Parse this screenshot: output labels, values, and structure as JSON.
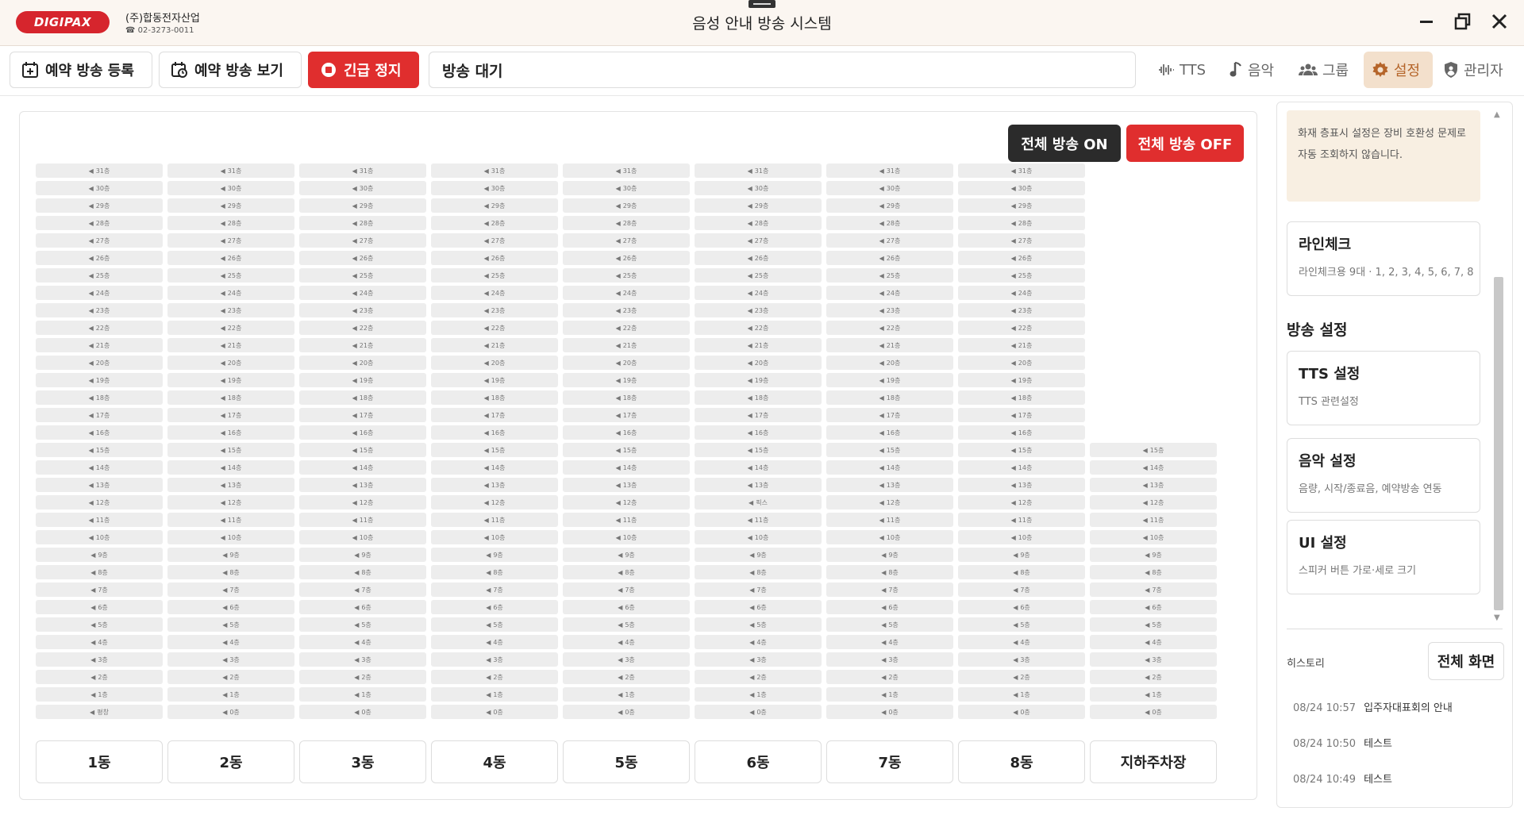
{
  "header": {
    "logo_text": "DIGIPAX",
    "company_name": "(주)합동전자산업",
    "company_phone": "☎ 02-3273-0011",
    "app_title": "음성 안내 방송 시스템",
    "brand_color": "#d6252d"
  },
  "toolbar": {
    "schedule_register": "예약 방송 등록",
    "schedule_view": "예약 방송 보기",
    "emergency_stop": "긴급 정지",
    "status_text": "방송 대기",
    "nav": {
      "tts": "TTS",
      "music": "음악",
      "group": "그룹",
      "settings": "설정",
      "admin": "관리자"
    }
  },
  "main": {
    "all_on": "전체 방송 ON",
    "all_off": "전체 방송 OFF",
    "buildings": [
      {
        "label": "1동",
        "floors": [
          "31층",
          "30층",
          "29층",
          "28층",
          "27층",
          "26층",
          "25층",
          "24층",
          "23층",
          "22층",
          "21층",
          "20층",
          "19층",
          "18층",
          "17층",
          "16층",
          "15층",
          "14층",
          "13층",
          "12층",
          "11층",
          "10층",
          "9층",
          "8층",
          "7층",
          "6층",
          "5층",
          "4층",
          "3층",
          "2층",
          "1층",
          "평창"
        ]
      },
      {
        "label": "2동",
        "floors": [
          "31층",
          "30층",
          "29층",
          "28층",
          "27층",
          "26층",
          "25층",
          "24층",
          "23층",
          "22층",
          "21층",
          "20층",
          "19층",
          "18층",
          "17층",
          "16층",
          "15층",
          "14층",
          "13층",
          "12층",
          "11층",
          "10층",
          "9층",
          "8층",
          "7층",
          "6층",
          "5층",
          "4층",
          "3층",
          "2층",
          "1층",
          "0층"
        ]
      },
      {
        "label": "3동",
        "floors": [
          "31층",
          "30층",
          "29층",
          "28층",
          "27층",
          "26층",
          "25층",
          "24층",
          "23층",
          "22층",
          "21층",
          "20층",
          "19층",
          "18층",
          "17층",
          "16층",
          "15층",
          "14층",
          "13층",
          "12층",
          "11층",
          "10층",
          "9층",
          "8층",
          "7층",
          "6층",
          "5층",
          "4층",
          "3층",
          "2층",
          "1층",
          "0층"
        ]
      },
      {
        "label": "4동",
        "floors": [
          "31층",
          "30층",
          "29층",
          "28층",
          "27층",
          "26층",
          "25층",
          "24층",
          "23층",
          "22층",
          "21층",
          "20층",
          "19층",
          "18층",
          "17층",
          "16층",
          "15층",
          "14층",
          "13층",
          "12층",
          "11층",
          "10층",
          "9층",
          "8층",
          "7층",
          "6층",
          "5층",
          "4층",
          "3층",
          "2층",
          "1층",
          "0층"
        ]
      },
      {
        "label": "5동",
        "floors": [
          "31층",
          "30층",
          "29층",
          "28층",
          "27층",
          "26층",
          "25층",
          "24층",
          "23층",
          "22층",
          "21층",
          "20층",
          "19층",
          "18층",
          "17층",
          "16층",
          "15층",
          "14층",
          "13층",
          "12층",
          "11층",
          "10층",
          "9층",
          "8층",
          "7층",
          "6층",
          "5층",
          "4층",
          "3층",
          "2층",
          "1층",
          "0층"
        ]
      },
      {
        "label": "6동",
        "floors": [
          "31층",
          "30층",
          "29층",
          "28층",
          "27층",
          "26층",
          "25층",
          "24층",
          "23층",
          "22층",
          "21층",
          "20층",
          "19층",
          "18층",
          "17층",
          "16층",
          "15층",
          "14층",
          "13층",
          "픽스",
          "11층",
          "10층",
          "9층",
          "8층",
          "7층",
          "6층",
          "5층",
          "4층",
          "3층",
          "2층",
          "1층",
          "0층"
        ]
      },
      {
        "label": "7동",
        "floors": [
          "31층",
          "30층",
          "29층",
          "28층",
          "27층",
          "26층",
          "25층",
          "24층",
          "23층",
          "22층",
          "21층",
          "20층",
          "19층",
          "18층",
          "17층",
          "16층",
          "15층",
          "14층",
          "13층",
          "12층",
          "11층",
          "10층",
          "9층",
          "8층",
          "7층",
          "6층",
          "5층",
          "4층",
          "3층",
          "2층",
          "1층",
          "0층"
        ]
      },
      {
        "label": "8동",
        "floors": [
          "31층",
          "30층",
          "29층",
          "28층",
          "27층",
          "26층",
          "25층",
          "24층",
          "23층",
          "22층",
          "21층",
          "20층",
          "19층",
          "18층",
          "17층",
          "16층",
          "15층",
          "14층",
          "13층",
          "12층",
          "11층",
          "10층",
          "9층",
          "8층",
          "7층",
          "6층",
          "5층",
          "4층",
          "3층",
          "2층",
          "1층",
          "0층"
        ]
      },
      {
        "label": "지하주차장",
        "floors": [
          "15층",
          "14층",
          "13층",
          "12층",
          "11층",
          "10층",
          "9층",
          "8층",
          "7층",
          "6층",
          "5층",
          "4층",
          "3층",
          "2층",
          "1층",
          "0층"
        ]
      }
    ]
  },
  "sidebar": {
    "note": "화재 층표시 설정은 장비 호환성 문제로 자동 조회하지 않습니다.",
    "linecheck": {
      "title": "라인체크",
      "desc": "라인체크용 9대 · 1, 2, 3, 4, 5, 6, 7, 8"
    },
    "section_title": "방송 설정",
    "cards": [
      {
        "title": "TTS 설정",
        "desc": "TTS 관련설정"
      },
      {
        "title": "음악 설정",
        "desc": "음량, 시작/종료음, 예약방송 연동"
      },
      {
        "title": "UI 설정",
        "desc": "스피커 버튼 가로·세로 크기"
      }
    ],
    "history_label": "히스토리",
    "fullscreen": "전체 화면",
    "history": [
      {
        "time": "08/24 10:57",
        "text": "입주자대표회의 안내"
      },
      {
        "time": "08/24 10:50",
        "text": "테스트"
      },
      {
        "time": "08/24 10:49",
        "text": "테스트"
      }
    ]
  }
}
